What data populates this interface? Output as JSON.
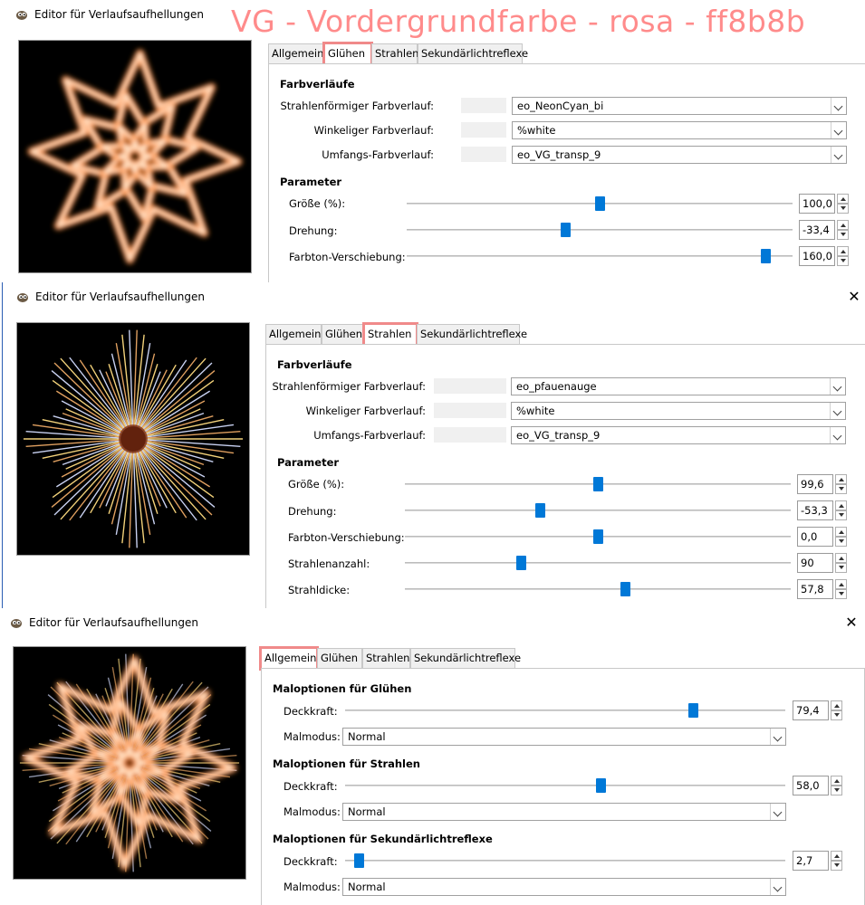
{
  "overlay_title": "VG - Vordergrundfarbe - rosa - ff8b8b",
  "accent": "#0078d7",
  "highlight_color": "#f08a8a",
  "dialogs": [
    {
      "title": "Editor für Verlaufsaufhellungen",
      "tabs": [
        {
          "label": "Allgemein"
        },
        {
          "label": "Glühen",
          "active": true,
          "highlighted": true
        },
        {
          "label": "Strahlen"
        },
        {
          "label": "Sekundärlichtreflexe"
        }
      ],
      "sections": [
        {
          "title": "Farbverläufe",
          "gradients": [
            {
              "label": "Strahlenförmiger Farbverlauf:",
              "value": "eo_NeonCyan_bi"
            },
            {
              "label": "Winkeliger Farbverlauf:",
              "value": "%white"
            },
            {
              "label": "Umfangs-Farbverlauf:",
              "value": "eo_VG_transp_9"
            }
          ]
        },
        {
          "title": "Parameter",
          "params": [
            {
              "label": "Größe (%):",
              "value": "100,0",
              "level": 0.5
            },
            {
              "label": "Drehung:",
              "value": "-33,4",
              "level": 0.41
            },
            {
              "label": "Farbton-Verschiebung:",
              "value": "160,0",
              "level": 0.93
            }
          ]
        }
      ]
    },
    {
      "title": "Editor für Verlaufsaufhellungen",
      "tabs": [
        {
          "label": "Allgemein"
        },
        {
          "label": "Glühen"
        },
        {
          "label": "Strahlen",
          "active": true,
          "highlighted": true
        },
        {
          "label": "Sekundärlichtreflexe"
        }
      ],
      "sections": [
        {
          "title": "Farbverläufe",
          "gradients": [
            {
              "label": "Strahlenförmiger Farbverlauf:",
              "value": "eo_pfauenauge"
            },
            {
              "label": "Winkeliger Farbverlauf:",
              "value": "%white"
            },
            {
              "label": "Umfangs-Farbverlauf:",
              "value": "eo_VG_transp_9"
            }
          ]
        },
        {
          "title": "Parameter",
          "params": [
            {
              "label": "Größe (%):",
              "value": "99,6",
              "level": 0.5
            },
            {
              "label": "Drehung:",
              "value": "-53,3",
              "level": 0.35
            },
            {
              "label": "Farbton-Verschiebung:",
              "value": "0,0",
              "level": 0.5
            },
            {
              "label": "Strahlenanzahl:",
              "value": "90",
              "level": 0.3
            },
            {
              "label": "Strahldicke:",
              "value": "57,8",
              "level": 0.57
            }
          ]
        }
      ]
    },
    {
      "title": "Editor für Verlaufsaufhellungen",
      "tabs": [
        {
          "label": "Allgemein",
          "active": true,
          "highlighted": true
        },
        {
          "label": "Glühen"
        },
        {
          "label": "Strahlen"
        },
        {
          "label": "Sekundärlichtreflexe"
        }
      ],
      "paint_sections": [
        {
          "title": "Maloptionen für Glühen",
          "opacity_label": "Deckkraft:",
          "opacity": "79,4",
          "level": 0.79,
          "mode_label": "Malmodus:",
          "mode": "Normal"
        },
        {
          "title": "Maloptionen für Strahlen",
          "opacity_label": "Deckkraft:",
          "opacity": "58,0",
          "level": 0.58,
          "mode_label": "Malmodus:",
          "mode": "Normal"
        },
        {
          "title": "Maloptionen für Sekundärlichtreflexe",
          "opacity_label": "Deckkraft:",
          "opacity": "2,7",
          "level": 0.03,
          "mode_label": "Malmodus:",
          "mode": "Normal"
        }
      ]
    }
  ]
}
